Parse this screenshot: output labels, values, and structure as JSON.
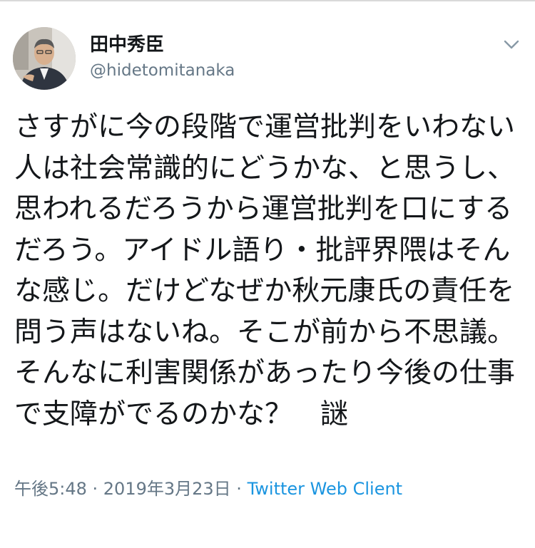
{
  "tweet": {
    "author": {
      "display_name": "田中秀臣",
      "handle": "@hidetomitanaka"
    },
    "text": "さすがに今の段階で運営批判をいわない人は社会常識的にどうかな、と思うし、思われるだろうから運営批判を口にするだろう。アイドル語り・批評界隈はそんな感じ。だけどなぜか秋元康氏の責任を問う声はないね。そこが前から不思議。そんなに利害関係があったり今後の仕事で支障がでるのかな？　謎",
    "timestamp": "午後5:48 · 2019年3月23日 ·",
    "client": "Twitter Web Client"
  },
  "icons": {
    "more": "chevron-down-icon"
  },
  "colors": {
    "primary_text": "#14171a",
    "secondary_text": "#657786",
    "link": "#1b95e0"
  }
}
